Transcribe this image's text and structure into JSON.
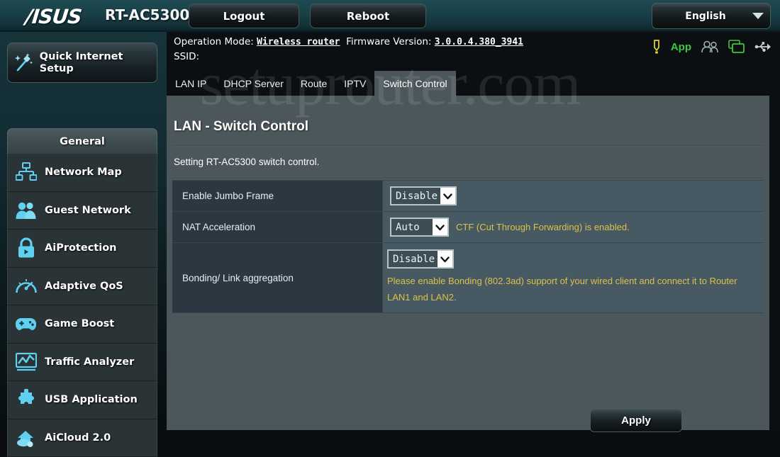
{
  "header": {
    "brand": "/ISUS",
    "model": "RT-AC5300",
    "logout_label": "Logout",
    "reboot_label": "Reboot",
    "language": "English",
    "caret_icon": "chevron-down-icon"
  },
  "info": {
    "operation_mode_label": "Operation Mode:",
    "operation_mode_value": "Wireless router",
    "firmware_label": "Firmware Version:",
    "firmware_value": "3.0.0.4.380_3941",
    "ssid_label": "SSID:",
    "ssid_value": ""
  },
  "status_icons": [
    {
      "name": "alert-icon",
      "color": "#e8d53a"
    },
    {
      "name": "app-label",
      "text": "App",
      "color": "#3ec63e"
    },
    {
      "name": "clients-icon",
      "color": "#9fb0b5"
    },
    {
      "name": "usb-device-icon",
      "color": "#3ec63e"
    },
    {
      "name": "usb-icon",
      "color": "#c5d2d6"
    }
  ],
  "tabs": [
    {
      "label": "LAN IP",
      "active": false
    },
    {
      "label": "DHCP Server",
      "active": false
    },
    {
      "label": "Route",
      "active": false
    },
    {
      "label": "IPTV",
      "active": false
    },
    {
      "label": "Switch Control",
      "active": true
    }
  ],
  "sidebar": {
    "quick_setup": {
      "label": "Quick Internet Setup",
      "icon": "magic-wand-icon"
    },
    "section_header": "General",
    "items": [
      {
        "label": "Network Map",
        "icon": "network-map-icon"
      },
      {
        "label": "Guest Network",
        "icon": "guest-network-icon"
      },
      {
        "label": "AiProtection",
        "icon": "lock-icon"
      },
      {
        "label": "Adaptive QoS",
        "icon": "gauge-icon"
      },
      {
        "label": "Game Boost",
        "icon": "gamepad-icon"
      },
      {
        "label": "Traffic Analyzer",
        "icon": "chart-icon"
      },
      {
        "label": "USB Application",
        "icon": "puzzle-piece-icon"
      },
      {
        "label": "AiCloud 2.0",
        "icon": "cloud-home-icon"
      }
    ]
  },
  "main": {
    "title": "LAN - Switch Control",
    "description": "Setting RT-AC5300 switch control.",
    "rows": [
      {
        "label": "Enable Jumbo Frame",
        "value": "Disable",
        "hint": "",
        "select_name": "jumbo-frame-select"
      },
      {
        "label": "NAT Acceleration",
        "value": "Auto",
        "hint": "CTF (Cut Through Forwarding) is enabled.",
        "select_name": "nat-acceleration-select"
      },
      {
        "label": "Bonding/ Link aggregation",
        "value": "Disable",
        "hint": "Please enable Bonding (802.3ad) support of your wired client and connect it to Router LAN1 and LAN2.",
        "select_name": "bonding-select"
      }
    ],
    "apply_label": "Apply"
  },
  "watermark": "setuprouter.com",
  "colors": {
    "panel_bg": "#4c575c",
    "row_label_bg": "#2b3841",
    "row_value_bg": "#475a63",
    "hint_yellow": "#ddc04a",
    "accent_cyan": "#4fc3e8",
    "header_teal": "#1a4149"
  }
}
